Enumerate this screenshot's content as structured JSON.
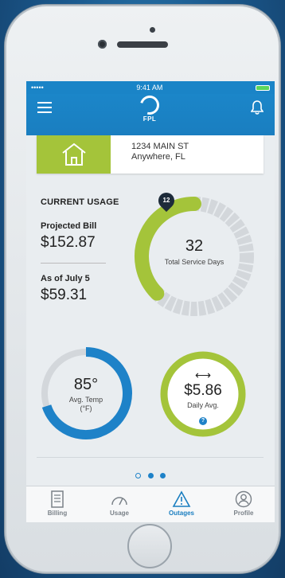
{
  "status": {
    "time": "9:41 AM",
    "signal": "•••••"
  },
  "app": {
    "logo_text": "FPL"
  },
  "address": {
    "line1": "1234 MAIN ST",
    "line2": "Anywhere, FL"
  },
  "usage": {
    "title": "CURRENT USAGE",
    "projected_label": "Projected Bill",
    "projected_amount": "$152.87",
    "asof_label": "As of July 5",
    "asof_amount": "$59.31",
    "service_days": "32",
    "service_days_label": "Total Service Days",
    "pin_value": "12",
    "service_progress_fraction": 0.375
  },
  "temp": {
    "value": "85°",
    "label": "Avg. Temp",
    "unit": "(°F)",
    "progress_fraction": 0.7
  },
  "daily": {
    "arrow": "⟷",
    "value": "$5.86",
    "label": "Daily Avg.",
    "info": "?"
  },
  "pager": {
    "count": 3,
    "active_index": 1
  },
  "tabs": [
    {
      "label": "Billing",
      "icon": "document-icon"
    },
    {
      "label": "Usage",
      "icon": "gauge-icon"
    },
    {
      "label": "Outages",
      "icon": "warning-icon",
      "active": true
    },
    {
      "label": "Profile",
      "icon": "user-icon"
    }
  ],
  "colors": {
    "brand_blue": "#1a84c7",
    "accent_green": "#a4c43a",
    "temp_blue": "#1e82c8"
  }
}
